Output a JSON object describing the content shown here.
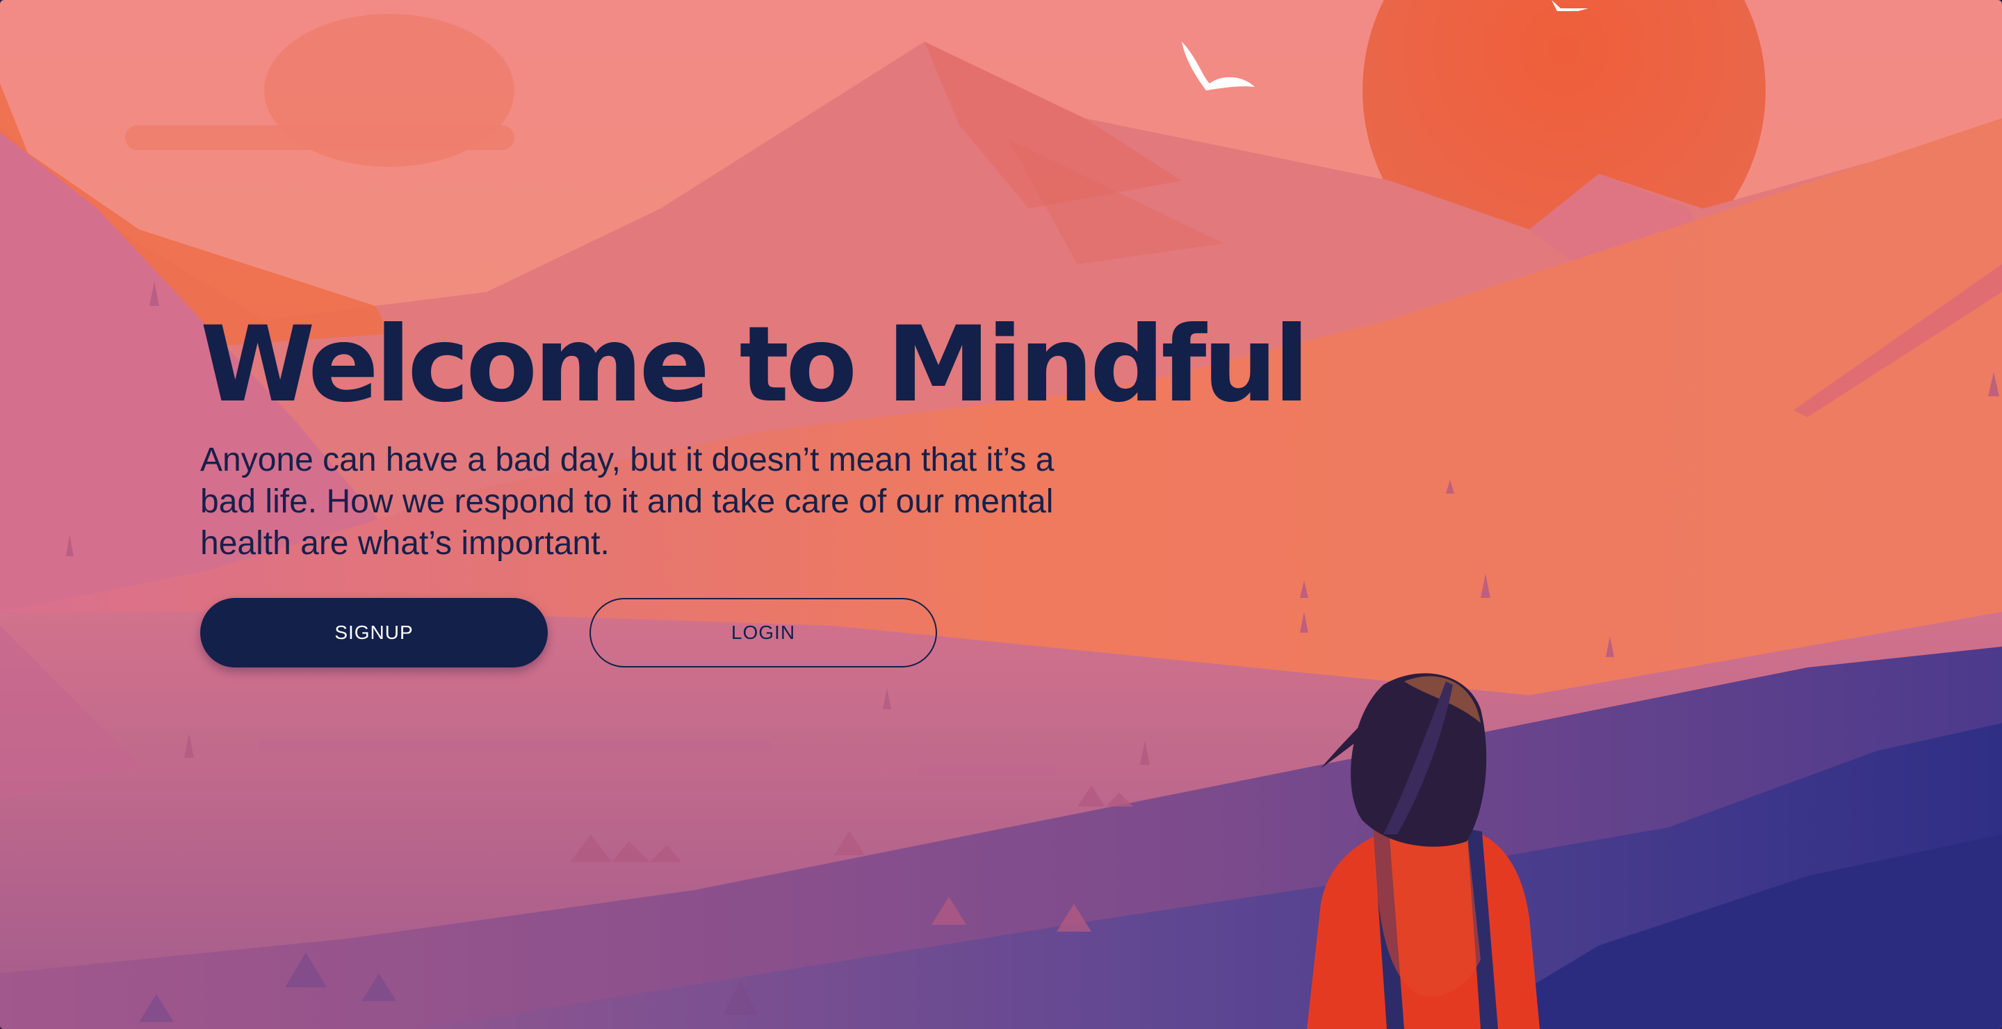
{
  "hero": {
    "title": "Welcome to Mindful",
    "subtitle": "Anyone can have a bad day, but it doesn’t mean that it’s a bad life. How we respond to it and take care of our mental health are what’s important."
  },
  "actions": {
    "signup_label": "SIGNUP",
    "login_label": "LOGIN"
  },
  "theme": {
    "title_color": "#13204a",
    "sky_top": "#f08a86",
    "sun": "#ee5a38",
    "valley_purple": "#3a2d7a",
    "jacket_red": "#e53a22"
  },
  "background": {
    "illustration": "mountain-sunset-landscape",
    "elements": [
      "sun",
      "cloud",
      "bird",
      "mountains",
      "hills",
      "trees",
      "girl-looking-at-mountains"
    ]
  }
}
